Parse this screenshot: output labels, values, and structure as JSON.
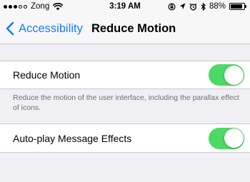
{
  "status_bar": {
    "carrier": "Zong",
    "time": "3:19 AM",
    "battery": "88%",
    "battery_level": 0.88,
    "icons": [
      "signal-dots",
      "wifi-icon",
      "orientation-lock-icon",
      "location-arrow-icon",
      "alarm-icon",
      "bluetooth-icon",
      "battery-icon"
    ]
  },
  "nav": {
    "back_label": "Accessibility",
    "title": "Reduce Motion"
  },
  "settings": {
    "reduce_motion": {
      "label": "Reduce Motion",
      "enabled": true
    },
    "reduce_motion_footer": "Reduce the motion of the user interface, including the parallax effect of icons.",
    "auto_play": {
      "label": "Auto-play Message Effects",
      "enabled": true
    }
  },
  "colors": {
    "accent": "#157efb",
    "toggle_on": "#4cd964",
    "background": "#efeff4"
  }
}
